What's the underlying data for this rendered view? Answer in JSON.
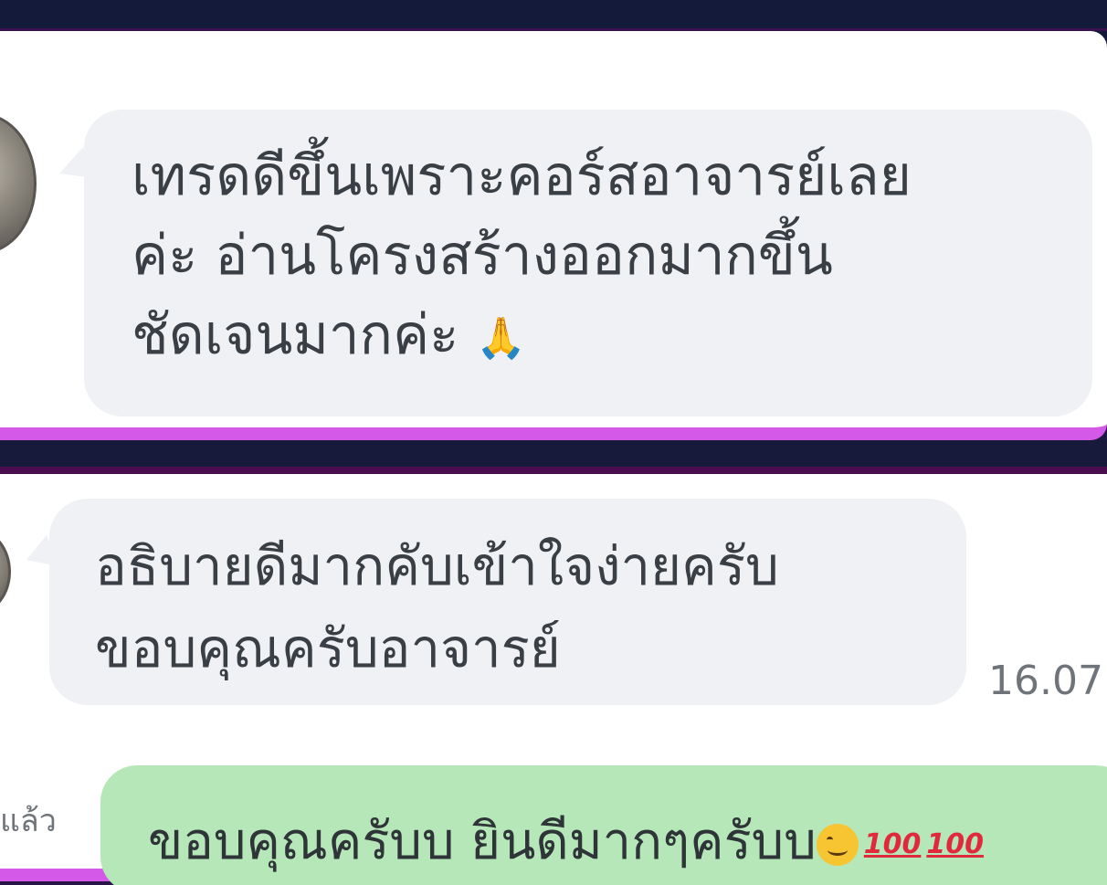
{
  "messages": {
    "first": {
      "line1": "เทรดดีขึ้นเพราะคอร์สอาจารย์เลย",
      "line2": "ค่ะ อ่านโครงสร้างออกมากขึ้น",
      "line3": "ชัดเจนมากค่ะ",
      "emoji": "🙏"
    },
    "second": {
      "line1": "อธิบายดีมากคับเข้าใจง่ายครับ",
      "line2": "ขอบคุณครับอาจารย์",
      "timestamp": "16.07"
    },
    "reply": {
      "text": "ขอบคุณครับบ ยินดีมากๆครับบ",
      "emoji_100": "100",
      "read_status": "แล้ว"
    }
  },
  "icons": [
    "avatar",
    "praying-hands-icon",
    "smile-emoji-icon",
    "hundred-points-icon"
  ],
  "colors": {
    "incoming_bubble": "#eff1f4",
    "outgoing_bubble": "#b6e7b9",
    "frame_accent": "#d559e8",
    "background": "#171a3b"
  }
}
